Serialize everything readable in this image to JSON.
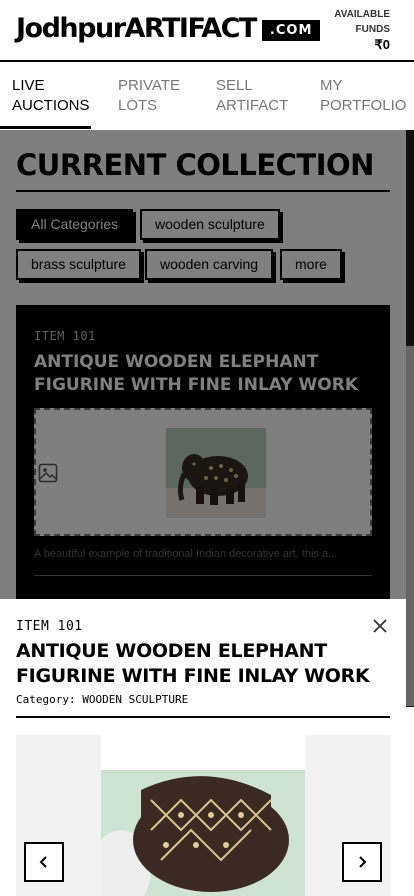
{
  "header": {
    "logo_main": "JodhpurARTIFACT",
    "logo_suffix": ".COM",
    "funds_label": "AVAILABLE FUNDS",
    "funds_value": "₹0"
  },
  "nav": {
    "tabs": [
      {
        "line1": "LIVE",
        "line2": "AUCTIONS"
      },
      {
        "line1": "PRIVATE",
        "line2": "LOTS"
      },
      {
        "line1": "SELL",
        "line2": "ARTIFACT"
      },
      {
        "line1": "MY",
        "line2": "PORTFOLIO"
      }
    ]
  },
  "main": {
    "title": "CURRENT COLLECTION",
    "filters": [
      "All Categories",
      "wooden sculpture",
      "brass sculpture",
      "wooden carving",
      "more"
    ],
    "card": {
      "item_id": "ITEM 101",
      "title": "ANTIQUE WOODEN ELEPHANT FIGURINE WITH FINE INLAY WORK",
      "description": "A beautiful example of traditional Indian decorative art, this a..."
    }
  },
  "modal": {
    "item_id": "ITEM 101",
    "title": "ANTIQUE WOODEN ELEPHANT FIGURINE WITH FINE INLAY WORK",
    "category_label": "Category:",
    "category_value": "WOODEN SCULPTURE"
  },
  "colors": {
    "ink": "#000000",
    "background": "#ffffff",
    "overlay": "rgba(0,0,0,0.5)"
  },
  "icons": [
    "image-placeholder-icon",
    "close-icon",
    "chevron-left-icon",
    "chevron-right-icon"
  ]
}
